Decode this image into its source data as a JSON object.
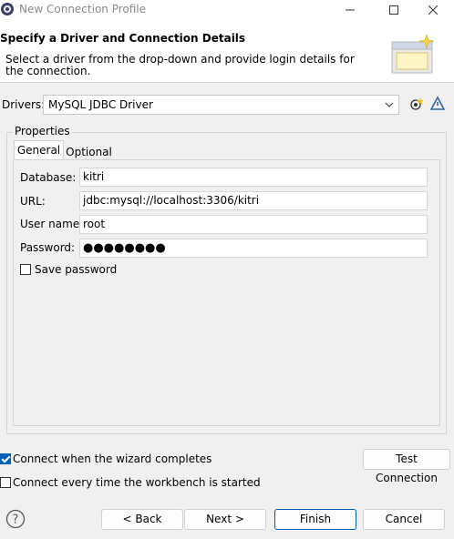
{
  "window": {
    "title": "New Connection Profile"
  },
  "header": {
    "title": "Specify a Driver and Connection Details",
    "description": "Select a driver from the drop-down and provide login details for the connection."
  },
  "drivers": {
    "label": "Drivers:",
    "selected": "MySQL JDBC Driver"
  },
  "properties": {
    "group_label": "Properties",
    "tabs": [
      {
        "label": "General",
        "active": true
      },
      {
        "label": "Optional",
        "active": false
      }
    ],
    "fields": {
      "database": {
        "label": "Database:",
        "value": "kitri"
      },
      "url": {
        "label": "URL:",
        "value": "jdbc:mysql://localhost:3306/kitri"
      },
      "username": {
        "label": "User name:",
        "value": "root"
      },
      "password": {
        "label": "Password:",
        "value": "●●●●●●●●"
      }
    },
    "save_password": {
      "label": "Save password",
      "checked": false
    }
  },
  "options": {
    "connect_on_finish": {
      "label": "Connect when the wizard completes",
      "checked": true
    },
    "connect_on_startup": {
      "label": "Connect every time the workbench is started",
      "checked": false
    }
  },
  "buttons": {
    "test_connection": "Test Connection",
    "back": "< Back",
    "next": "Next >",
    "finish": "Finish",
    "cancel": "Cancel"
  },
  "colors": {
    "accent": "#005fb8",
    "background": "#f0f0f0"
  },
  "icons": [
    "app-icon",
    "minimize-icon",
    "maximize-icon",
    "close-icon",
    "wizard-banner-icon",
    "chevron-down-icon",
    "new-driver-icon",
    "edit-driver-icon",
    "help-icon"
  ]
}
